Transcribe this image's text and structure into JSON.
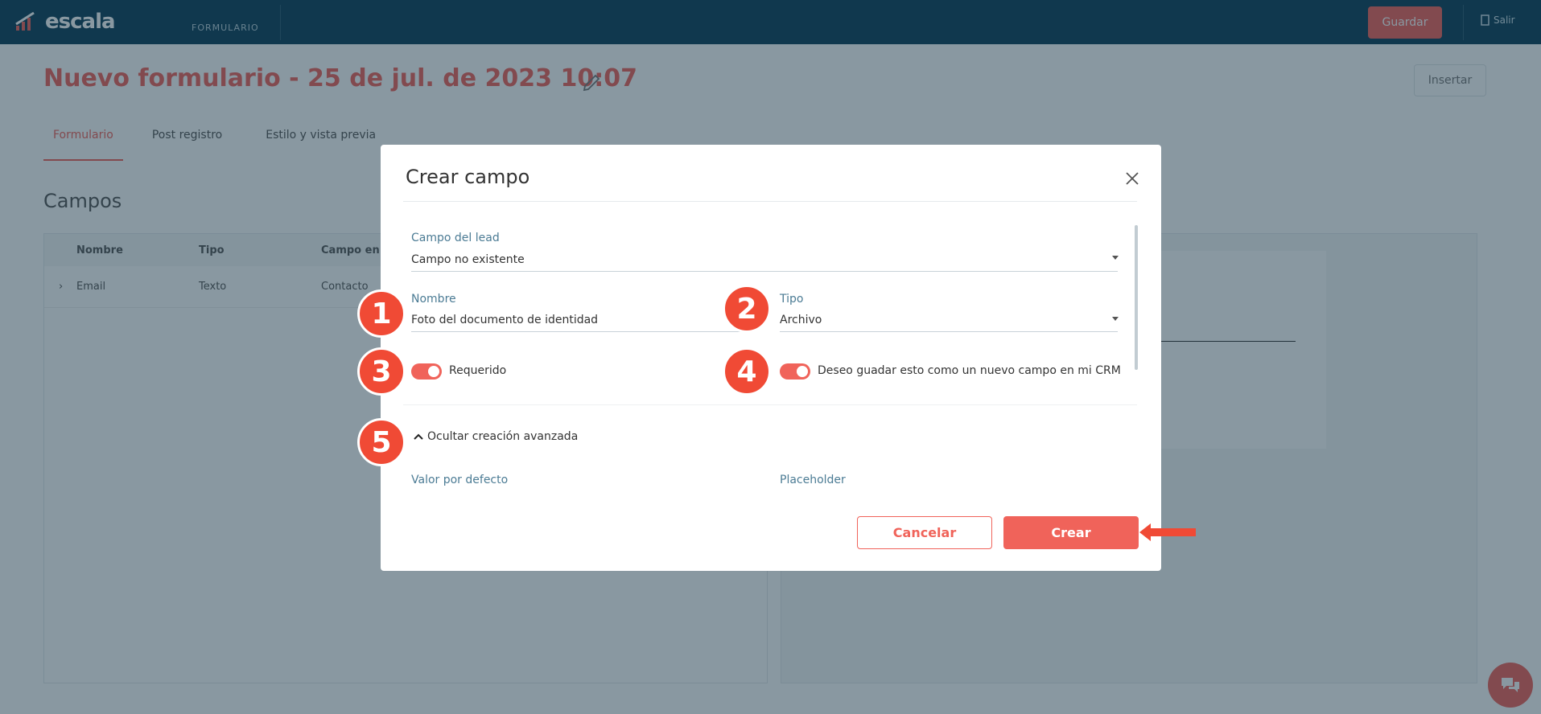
{
  "app": {
    "logo_text": "escala",
    "section": "FORMULARIO",
    "save_button": "Guardar",
    "exit_label": "Salir"
  },
  "page": {
    "title": "Nuevo formulario - 25 de jul. de 2023 10:07",
    "insert_button": "Insertar",
    "tabs": [
      "Formulario",
      "Post registro",
      "Estilo y vista previa"
    ],
    "fields_title": "Campos",
    "table": {
      "headers": [
        "Nombre",
        "Tipo",
        "Campo en"
      ],
      "rows": [
        [
          "Email",
          "Texto",
          "Contacto"
        ]
      ]
    }
  },
  "modal": {
    "title": "Crear campo",
    "lead_field": {
      "label": "Campo del lead",
      "value": "Campo no existente"
    },
    "name_field": {
      "label": "Nombre",
      "value": "Foto del documento de identidad"
    },
    "type_field": {
      "label": "Tipo",
      "value": "Archivo"
    },
    "required_toggle": {
      "label": "Requerido",
      "on": true
    },
    "crm_toggle": {
      "label": "Deseo guadar esto como un nuevo campo en mi CRM",
      "on": true
    },
    "advanced_toggle": "Ocultar creación avanzada",
    "default_value_label": "Valor por defecto",
    "placeholder_label": "Placeholder",
    "cancel_button": "Cancelar",
    "create_button": "Crear"
  },
  "annotations": [
    "1",
    "2",
    "3",
    "4",
    "5"
  ],
  "colors": {
    "topbar": "#0d3f58",
    "accent": "#f0635a",
    "badge": "#f04a35",
    "label": "#4b7b94"
  },
  "icons": [
    "logo-bars-icon",
    "pencil-icon",
    "close-icon",
    "chevron-up-icon",
    "dropdown-caret-icon",
    "exit-icon",
    "chat-icon",
    "arrow-left-icon"
  ]
}
